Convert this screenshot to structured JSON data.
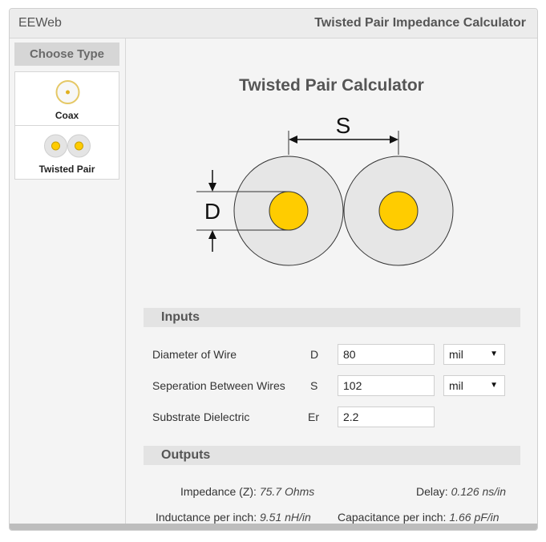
{
  "header": {
    "brand": "EEWeb",
    "title": "Twisted Pair Impedance Calculator"
  },
  "sidebar": {
    "heading": "Choose Type",
    "items": [
      {
        "label": "Coax",
        "icon": "coax-icon"
      },
      {
        "label": "Twisted Pair",
        "icon": "twisted-pair-icon"
      }
    ]
  },
  "main": {
    "title": "Twisted Pair Calculator",
    "diagram": {
      "spacing_label": "S",
      "diameter_label": "D"
    },
    "inputs_heading": "Inputs",
    "inputs": [
      {
        "label": "Diameter of Wire",
        "symbol": "D",
        "value": "80",
        "unit": "mil"
      },
      {
        "label": "Seperation Between Wires",
        "symbol": "S",
        "value": "102",
        "unit": "mil"
      },
      {
        "label": "Substrate Dielectric",
        "symbol": "Er",
        "value": "2.2"
      }
    ],
    "outputs_heading": "Outputs",
    "outputs": {
      "impedance_label": "Impedance (Z):",
      "impedance_value": "75.7 Ohms",
      "delay_label": "Delay:",
      "delay_value": "0.126 ns/in",
      "inductance_label": "Inductance per inch:",
      "inductance_value": "9.51 nH/in",
      "capacitance_label": "Capacitance per inch:",
      "capacitance_value": "1.66 pF/in"
    }
  },
  "colors": {
    "conductor": "#ffcc00",
    "insulation": "#e6e6e6",
    "section_bar": "#e3e3e3"
  }
}
